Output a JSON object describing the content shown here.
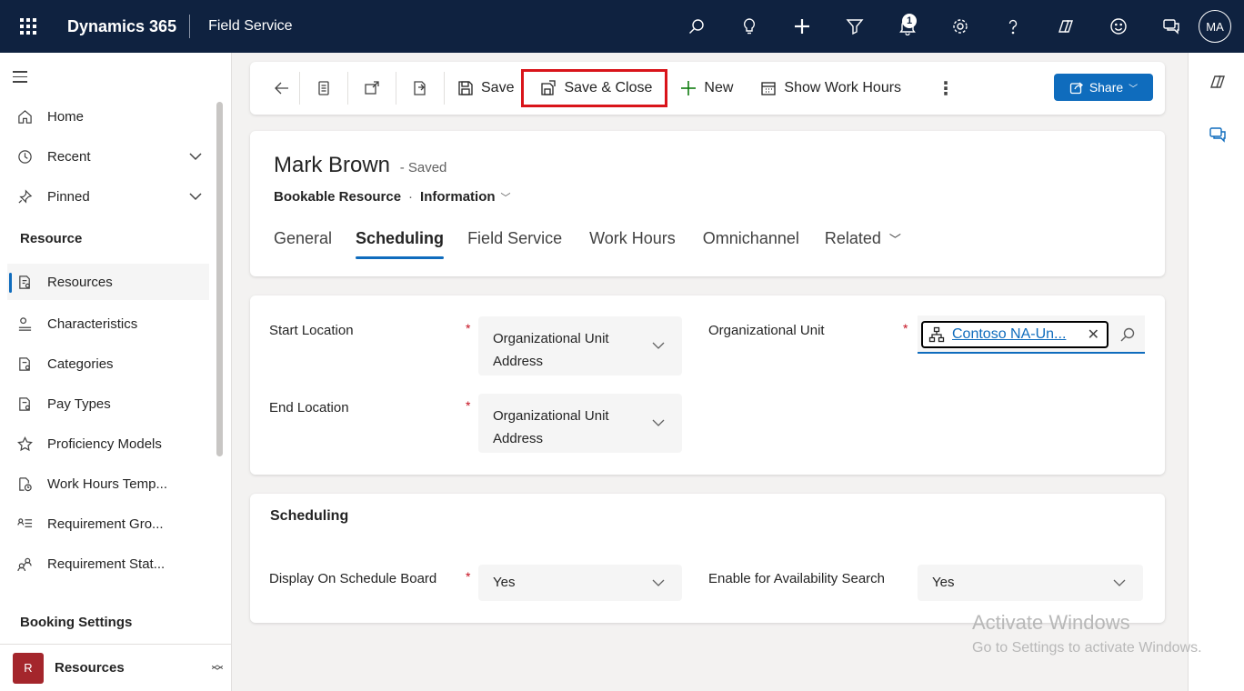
{
  "topbar": {
    "app_name": "Dynamics 365",
    "area_name": "Field Service",
    "notification_count": "1",
    "user_initials": "MA"
  },
  "nav": {
    "home": "Home",
    "recent": "Recent",
    "pinned": "Pinned",
    "section_resource": "Resource",
    "items": [
      "Resources",
      "Characteristics",
      "Categories",
      "Pay Types",
      "Proficiency Models",
      "Work Hours Temp...",
      "Requirement Gro...",
      "Requirement Stat..."
    ],
    "section_booking": "Booking Settings",
    "area_badge": "R",
    "area_label": "Resources"
  },
  "commandbar": {
    "save": "Save",
    "save_close": "Save & Close",
    "new": "New",
    "show_work_hours": "Show Work Hours",
    "share": "Share"
  },
  "record": {
    "title": "Mark Brown",
    "status": "- Saved",
    "entity": "Bookable Resource",
    "form": "Information",
    "tabs": [
      "General",
      "Scheduling",
      "Field Service",
      "Work Hours",
      "Omnichannel",
      "Related"
    ]
  },
  "location": {
    "start_label": "Start Location",
    "start_value_line1": "Organizational Unit",
    "start_value_line2": "Address",
    "end_label": "End Location",
    "end_value_line1": "Organizational Unit",
    "end_value_line2": "Address",
    "org_unit_label": "Organizational Unit",
    "org_unit_value": "Contoso NA-Un..."
  },
  "scheduling": {
    "title": "Scheduling",
    "display_label": "Display On Schedule Board",
    "display_value": "Yes",
    "availability_label": "Enable for Availability Search",
    "availability_value": "Yes"
  },
  "watermark": {
    "line1": "Activate Windows",
    "line2": "Go to Settings to activate Windows."
  },
  "colors": {
    "topbar": "#0f2240",
    "accent": "#0f6cbd",
    "highlight_border": "#d9141a",
    "required": "#c50f1f"
  }
}
